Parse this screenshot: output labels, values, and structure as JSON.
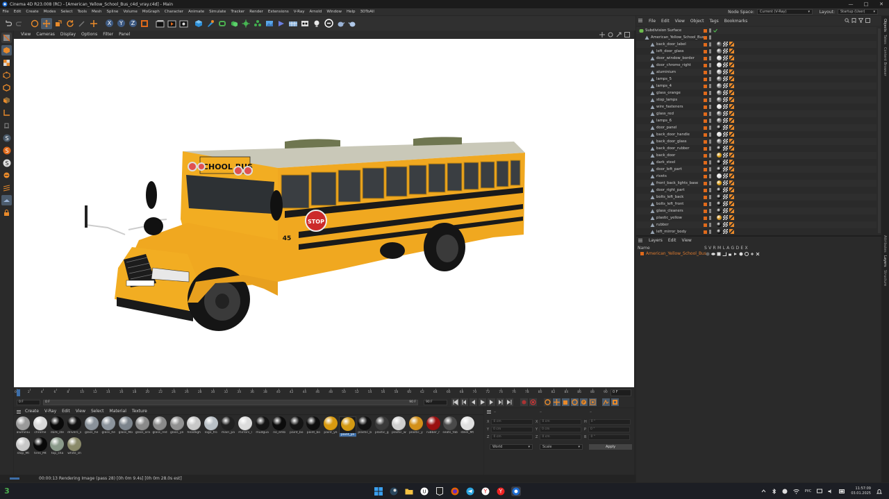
{
  "window": {
    "title": "Cinema 4D R23.008 (RC) - [American_Yellow_School_Bus_c4d_vray.c4d] - Main",
    "controls": [
      "—",
      "□",
      "✕"
    ]
  },
  "menubar": {
    "items": [
      "File",
      "Edit",
      "Create",
      "Modes",
      "Select",
      "Tools",
      "Mesh",
      "Spline",
      "Volume",
      "MoGraph",
      "Character",
      "Animate",
      "Simulate",
      "Tracker",
      "Render",
      "Extensions",
      "V-Ray",
      "Arnold",
      "Window",
      "Help",
      "3DToAll"
    ],
    "node_space_label": "Node Space:",
    "node_space_value": "Current (V-Ray)",
    "layout_label": "Layout:",
    "layout_value": "Startup (User)"
  },
  "viewport": {
    "menu": [
      "View",
      "Cameras",
      "Display",
      "Options",
      "Filter",
      "Panel"
    ],
    "bus_text": "SCHOOL BUS",
    "bus_number": "45",
    "stop_sign": "STOP"
  },
  "timeline": {
    "ticks": [
      "0",
      "2",
      "4",
      "6",
      "8",
      "10",
      "12",
      "14",
      "16",
      "18",
      "20",
      "22",
      "24",
      "26",
      "28",
      "30",
      "32",
      "34",
      "36",
      "38",
      "40",
      "42",
      "44",
      "46",
      "48",
      "50",
      "52",
      "54",
      "56",
      "58",
      "60",
      "62",
      "64",
      "66",
      "68",
      "70",
      "72",
      "74",
      "76",
      "78",
      "80",
      "82",
      "84",
      "86",
      "88",
      "90"
    ],
    "current_frame": "0 F",
    "end_field": "0 F",
    "start_field": "0 F",
    "min_field": "0 F",
    "max_field": "90 F",
    "max_field2": "90 F"
  },
  "material_manager": {
    "menu": [
      "Create",
      "V-Ray",
      "Edit",
      "View",
      "Select",
      "Material",
      "Texture"
    ],
    "materials": [
      {
        "name": "aluminiu",
        "color": "#9a9a9a"
      },
      {
        "name": "chrome",
        "color": "#d8d8d8"
      },
      {
        "name": "dark_ste",
        "color": "#0a0a0a"
      },
      {
        "name": "drivers_s",
        "color": "#111111"
      },
      {
        "name": "glass_he",
        "color": "#8a929a"
      },
      {
        "name": "glass_he",
        "color": "#8c949c"
      },
      {
        "name": "glass_Mo",
        "color": "#7c848c"
      },
      {
        "name": "glass_ora",
        "color": "#8a8a8a"
      },
      {
        "name": "glass_red",
        "color": "#8a8a8a"
      },
      {
        "name": "glass_ye",
        "color": "#909090"
      },
      {
        "name": "headligh",
        "color": "#c8c8c8"
      },
      {
        "name": "logo_fro",
        "color": "#b9c0c6"
      },
      {
        "name": "main_pa",
        "color": "#202020"
      },
      {
        "name": "mirrors_l",
        "color": "#dcdcdc"
      },
      {
        "name": "mudgua",
        "color": "#151515"
      },
      {
        "name": "no_emb",
        "color": "#0c0c0c"
      },
      {
        "name": "paint_bo",
        "color": "#141414"
      },
      {
        "name": "paint_bo",
        "color": "#0f0f0f"
      },
      {
        "name": "paint_ye",
        "color": "#d99a10"
      },
      {
        "name": "paint_ye",
        "color": "#d39a14"
      },
      {
        "name": "plastic_b",
        "color": "#121212"
      },
      {
        "name": "plastic_g",
        "color": "#3a3a3a"
      },
      {
        "name": "plastic_w",
        "color": "#cfcfcf"
      },
      {
        "name": "plastic_y",
        "color": "#d2901a"
      },
      {
        "name": "rubber_r",
        "color": "#9a1010"
      },
      {
        "name": "seats_fab",
        "color": "#4a4a4a"
      },
      {
        "name": "steel_Mt",
        "color": "#e0e0e0"
      },
      {
        "name": "stop_Mt",
        "color": "#c8c8c8"
      },
      {
        "name": "tires_Mt",
        "color": "#080808"
      },
      {
        "name": "top_sha",
        "color": "#8a9a8a"
      },
      {
        "name": "white_sh",
        "color": "#8a8a6a"
      }
    ],
    "selected_index": 19
  },
  "coordinates": {
    "rows": [
      {
        "axis": "X",
        "val": "0 cm",
        "axis2": "X",
        "val2": "0 cm",
        "axis3": "H",
        "val3": "0 °"
      },
      {
        "axis": "Y",
        "val": "0 cm",
        "axis2": "Y",
        "val2": "0 cm",
        "axis3": "P",
        "val3": "0 °"
      },
      {
        "axis": "Z",
        "val": "0 cm",
        "axis2": "Z",
        "val2": "0 cm",
        "axis3": "B",
        "val3": "0 °"
      }
    ],
    "world_label": "World",
    "scale_label": "Scale",
    "apply_label": "Apply"
  },
  "status": {
    "text": "00:00:13 Rendering Image (pass 28) [0h  0m  9.4s] [0h  0m 28.0s est]"
  },
  "object_manager": {
    "menu": [
      "File",
      "Edit",
      "View",
      "Object",
      "Tags",
      "Bookmarks"
    ],
    "objects": [
      {
        "name": "Subdivision Surface",
        "level": 0,
        "color": "#6dbb4e"
      },
      {
        "name": "American_Yellow_School_Bus",
        "level": 1,
        "color": "#9aa6b4"
      },
      {
        "name": "back_door_label",
        "level": 2,
        "color": "#9aa6b4",
        "tag": "#555"
      },
      {
        "name": "left_door_glass",
        "level": 2,
        "color": "#9aa6b4",
        "tag": "#777"
      },
      {
        "name": "door_window_border",
        "level": 2,
        "color": "#9aa6b4",
        "tag": "#ccc"
      },
      {
        "name": "door_chrome_right",
        "level": 2,
        "color": "#9aa6b4",
        "tag": "#ddd"
      },
      {
        "name": "aluminium",
        "level": 2,
        "color": "#9aa6b4",
        "tag": "#aaa"
      },
      {
        "name": "lamps_5",
        "level": 2,
        "color": "#9aa6b4",
        "tag": "#777"
      },
      {
        "name": "lamps_4",
        "level": 2,
        "color": "#9aa6b4",
        "tag": "#888"
      },
      {
        "name": "glass_orange",
        "level": 2,
        "color": "#9aa6b4",
        "tag": "#777"
      },
      {
        "name": "stop_lamps",
        "level": 2,
        "color": "#9aa6b4",
        "tag": "#777"
      },
      {
        "name": "wire_fasteners",
        "level": 2,
        "color": "#9aa6b4",
        "tag": "#ddd"
      },
      {
        "name": "glass_red",
        "level": 2,
        "color": "#9aa6b4",
        "tag": "#777"
      },
      {
        "name": "lamps_6",
        "level": 2,
        "color": "#9aa6b4",
        "tag": "#777"
      },
      {
        "name": "door_panel",
        "level": 2,
        "color": "#9aa6b4",
        "tag": "#111"
      },
      {
        "name": "back_door_handle",
        "level": 2,
        "color": "#9aa6b4",
        "tag": "#ddd"
      },
      {
        "name": "back_door_glass",
        "level": 2,
        "color": "#9aa6b4",
        "tag": "#777"
      },
      {
        "name": "back_door_rubber",
        "level": 2,
        "color": "#9aa6b4",
        "tag": "#111"
      },
      {
        "name": "back_door",
        "level": 2,
        "color": "#9aa6b4",
        "tag": "#d99a10"
      },
      {
        "name": "dark_steel",
        "level": 2,
        "color": "#9aa6b4",
        "tag": "#0a0a0a"
      },
      {
        "name": "door_left_part",
        "level": 2,
        "color": "#9aa6b4",
        "tag": "#111"
      },
      {
        "name": "rivets",
        "level": 2,
        "color": "#9aa6b4",
        "tag": "#ddd"
      },
      {
        "name": "front_back_lights_base",
        "level": 2,
        "color": "#9aa6b4",
        "tag": "#d99a10"
      },
      {
        "name": "door_right_part",
        "level": 2,
        "color": "#9aa6b4",
        "tag": "#111"
      },
      {
        "name": "bolts_left_back",
        "level": 2,
        "color": "#9aa6b4",
        "tag": "#111"
      },
      {
        "name": "bolts_left_front",
        "level": 2,
        "color": "#9aa6b4",
        "tag": "#111"
      },
      {
        "name": "glass_cleaners",
        "level": 2,
        "color": "#9aa6b4",
        "tag": "#111"
      },
      {
        "name": "plastic_yellow",
        "level": 2,
        "color": "#9aa6b4",
        "tag": "#d2901a"
      },
      {
        "name": "rubber",
        "level": 2,
        "color": "#9aa6b4",
        "tag": "#111"
      },
      {
        "name": "left_mirror_body",
        "level": 2,
        "color": "#9aa6b4",
        "tag": "#111"
      }
    ]
  },
  "layer_manager": {
    "menu": [
      "Layers",
      "Edit",
      "View"
    ],
    "header_name": "Name",
    "header_cols": "S V R M L A G D E X",
    "layer_name": "American_Yellow_School_Bus"
  },
  "side_tabs": [
    "Objects",
    "Takes",
    "Content Browser",
    "Attributes",
    "Layers",
    "Structure"
  ],
  "taskbar": {
    "time": "11:57:09",
    "date": "03.01.2025",
    "lang": "РУС",
    "start_badge": "3"
  }
}
